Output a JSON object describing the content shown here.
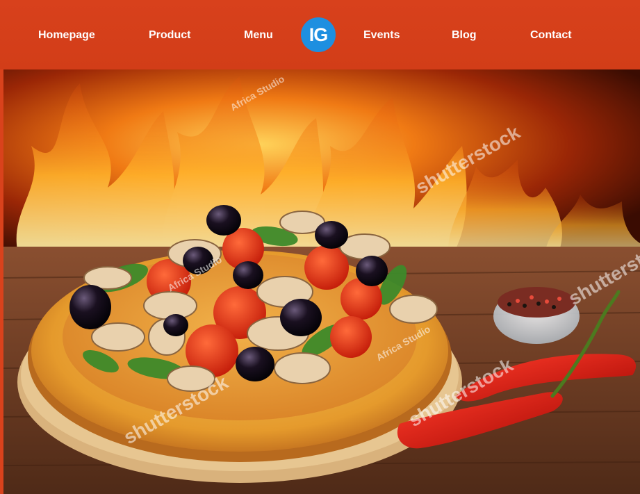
{
  "nav": {
    "items": [
      {
        "label": "Homepage"
      },
      {
        "label": "Product"
      },
      {
        "label": "Menu"
      },
      {
        "label": "Events"
      },
      {
        "label": "Blog"
      },
      {
        "label": "Contact"
      }
    ],
    "logo_text": "IG"
  },
  "hero": {
    "image_subject": "pizza-with-fire-and-chili",
    "watermarks": [
      "shutterstock",
      "Africa Studio"
    ]
  },
  "colors": {
    "nav_background": "#d8411c",
    "nav_text": "#ffffff",
    "logo_background": "#1e8fe0"
  }
}
